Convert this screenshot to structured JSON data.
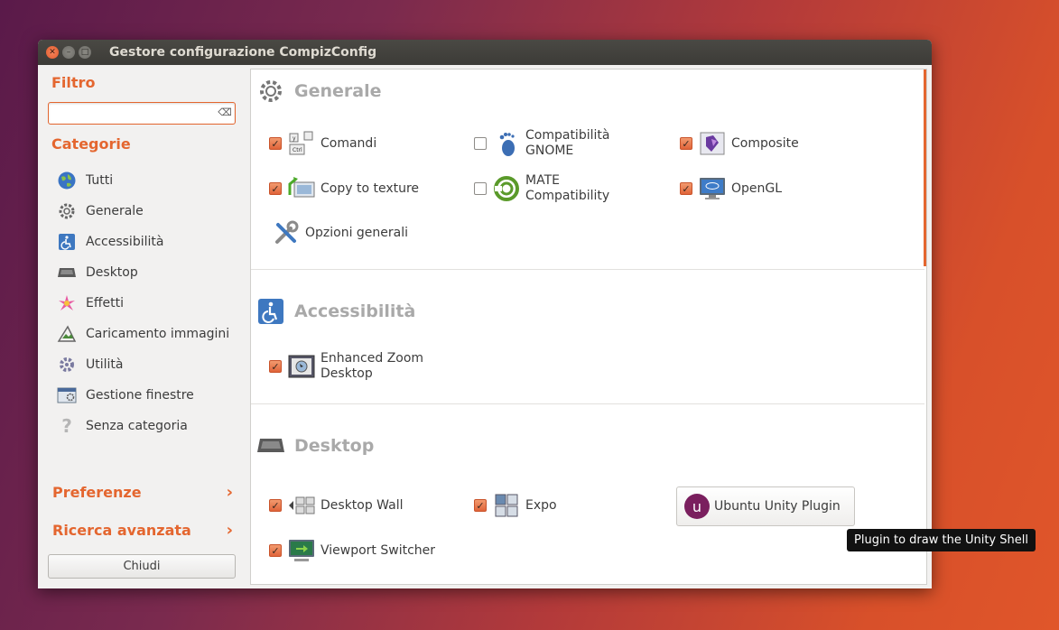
{
  "window": {
    "title": "Gestore configurazione CompizConfig"
  },
  "sidebar": {
    "filter_heading": "Filtro",
    "filter_value": "",
    "categories_heading": "Categorie",
    "categories": [
      {
        "label": "Tutti",
        "icon": "globe-icon"
      },
      {
        "label": "Generale",
        "icon": "gear-icon"
      },
      {
        "label": "Accessibilità",
        "icon": "accessibility-icon"
      },
      {
        "label": "Desktop",
        "icon": "desktop-icon"
      },
      {
        "label": "Effetti",
        "icon": "effects-icon"
      },
      {
        "label": "Caricamento immagini",
        "icon": "image-loading-icon"
      },
      {
        "label": "Utilità",
        "icon": "utility-icon"
      },
      {
        "label": "Gestione finestre",
        "icon": "window-management-icon"
      },
      {
        "label": "Senza categoria",
        "icon": "question-icon"
      }
    ],
    "preferences": "Preferenze",
    "advanced_search": "Ricerca avanzata",
    "close_button": "Chiudi"
  },
  "sections": {
    "generale": {
      "title": "Generale",
      "plugins": {
        "comandi": {
          "label": "Comandi",
          "checked": true
        },
        "gnome": {
          "label": "Compatibilità GNOME",
          "checked": false
        },
        "composite": {
          "label": "Composite",
          "checked": true
        },
        "copy_texture": {
          "label": "Copy to texture",
          "checked": true
        },
        "mate": {
          "label": "MATE Compatibility",
          "checked": false
        },
        "opengl": {
          "label": "OpenGL",
          "checked": true
        },
        "general_options": {
          "label": "Opzioni generali"
        }
      }
    },
    "accessibilita": {
      "title": "Accessibilità",
      "plugins": {
        "enhanced_zoom": {
          "label": "Enhanced Zoom Desktop",
          "checked": true
        }
      }
    },
    "desktop": {
      "title": "Desktop",
      "plugins": {
        "desktop_wall": {
          "label": "Desktop Wall",
          "checked": true
        },
        "expo": {
          "label": "Expo",
          "checked": true
        },
        "unity": {
          "label": "Ubuntu Unity Plugin"
        },
        "viewport": {
          "label": "Viewport Switcher",
          "checked": true
        }
      }
    }
  },
  "tooltip": "Plugin to draw the Unity Shell",
  "colors": {
    "accent": "#e4662f",
    "section_title": "#a9a9a9"
  }
}
